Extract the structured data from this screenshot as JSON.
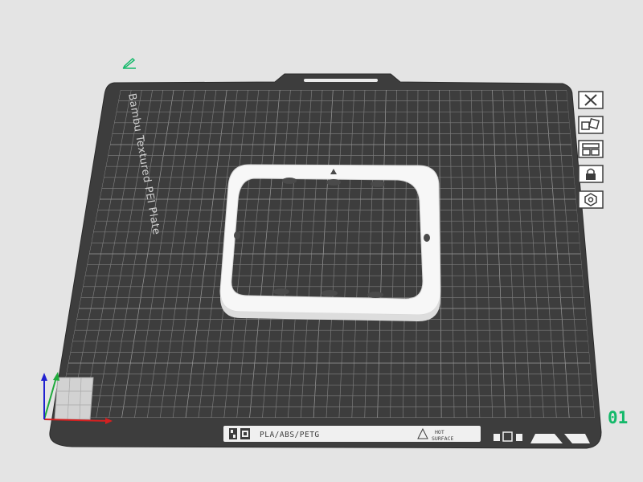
{
  "plate": {
    "name_label": "Bambu Textured PEI Plate",
    "material_label": "PLA/ABS/PETG",
    "warning_line1": "HOT",
    "warning_line2": "SURFACE",
    "number": "01"
  },
  "toolbar": {
    "items": [
      {
        "icon": "close-plate-icon"
      },
      {
        "icon": "arrange-icon"
      },
      {
        "icon": "orient-icon"
      },
      {
        "icon": "lock-icon"
      },
      {
        "icon": "settings-gear-icon"
      }
    ]
  },
  "colors": {
    "background": "#e4e4e4",
    "plate": "#3d3d3d",
    "grid": "#7a7a7a",
    "model": "#f7f7f7",
    "accent_green": "#14b96a",
    "axis_x": "#d42020",
    "axis_y": "#1faa3c",
    "axis_z": "#2020d0"
  }
}
